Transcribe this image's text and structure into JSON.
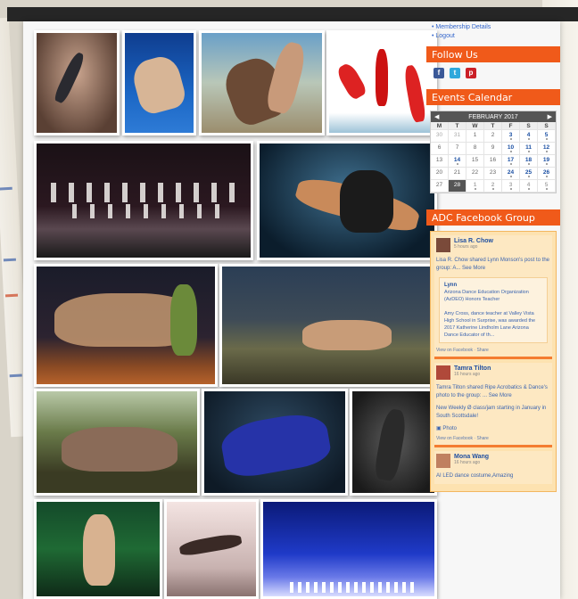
{
  "account_links": [
    "• Membership Details",
    "• Logout"
  ],
  "follow_us": {
    "title": "Follow Us",
    "icons": [
      "facebook-icon",
      "twitter-icon",
      "pinterest-icon"
    ]
  },
  "calendar": {
    "title": "Events Calendar",
    "prev": "◀",
    "month": "FEBRUARY 2017",
    "next": "▶",
    "dow": [
      "M",
      "T",
      "W",
      "T",
      "F",
      "S",
      "S"
    ],
    "weeks": [
      [
        "30",
        "31",
        "1",
        "2",
        "3",
        "4",
        "5"
      ],
      [
        "6",
        "7",
        "8",
        "9",
        "10",
        "11",
        "12"
      ],
      [
        "13",
        "14",
        "15",
        "16",
        "17",
        "18",
        "19"
      ],
      [
        "20",
        "21",
        "22",
        "23",
        "24",
        "25",
        "26"
      ],
      [
        "27",
        "28",
        "1",
        "2",
        "3",
        "4",
        "5"
      ]
    ]
  },
  "fb_group": {
    "title": "ADC Facebook Group",
    "posts": [
      {
        "name": "Lisa R. Chow",
        "time": "5 hours ago",
        "text": "Lisa R. Chow shared Lynn Monson's post to the group: A... See More",
        "share_title": "Lynn",
        "share_sub": "Arizona Dance Education Organization (AzDEO) Honors Teacher",
        "share_body": "Amy Cross, dance teacher at Valley Vista High School in Surprise, was awarded the 2017 Katherine Lindholm Lane Arizona Dance Educator of th...",
        "footer": "View on Facebook · Share"
      },
      {
        "name": "Tamra Tilton",
        "time": "16 hours ago",
        "text": "Tamra Tilton shared Ripe Acrobatics & Dance's photo to the group: ... See More",
        "extra": "New Weekly Ø class/jam starting in January in South Scottsdale!",
        "photo_label": "Photo",
        "footer": "View on Facebook · Share"
      },
      {
        "name": "Mona Wang",
        "time": "16 hours ago",
        "text": "AI LED dance costume,Amazing"
      }
    ]
  }
}
